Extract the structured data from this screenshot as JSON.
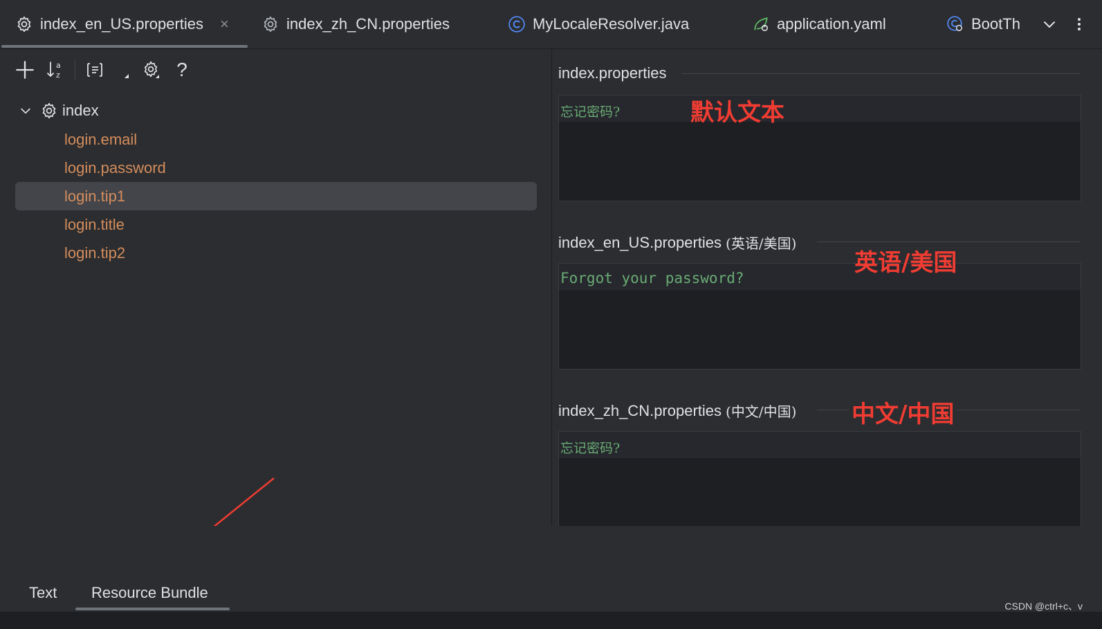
{
  "tabs": [
    {
      "label": "index_en_US.properties",
      "icon": "gear-icon",
      "active": true,
      "close": "×"
    },
    {
      "label": "index_zh_CN.properties",
      "icon": "gear-icon",
      "active": false
    },
    {
      "label": "MyLocaleResolver.java",
      "icon": "class-icon",
      "active": false
    },
    {
      "label": "application.yaml",
      "icon": "spring-icon",
      "active": false
    },
    {
      "label": "BootTh",
      "icon": "boot-icon",
      "active": false
    }
  ],
  "toolbar": {
    "help": "?"
  },
  "tree": {
    "root_label": "index",
    "items": [
      {
        "label": "login.email",
        "selected": false
      },
      {
        "label": "login.password",
        "selected": false
      },
      {
        "label": "login.tip1",
        "selected": true
      },
      {
        "label": "login.title",
        "selected": false
      },
      {
        "label": "login.tip2",
        "selected": false
      }
    ]
  },
  "bottom_tabs": [
    {
      "label": "Text",
      "active": false
    },
    {
      "label": "Resource Bundle",
      "active": true
    }
  ],
  "sections": [
    {
      "title": "index.properties",
      "locale": "",
      "value": "忘记密码?",
      "annotation": "默认文本"
    },
    {
      "title": "index_en_US.properties",
      "locale": "(英语/美国)",
      "value": "Forgot your password?",
      "annotation": "英语/美国"
    },
    {
      "title": "index_zh_CN.properties",
      "locale": "(中文/中国)",
      "value": "忘记密码?",
      "annotation": "中文/中国"
    }
  ],
  "watermark": "CSDN @ctrl+c、v",
  "colors": {
    "key_text": "#d58d5c",
    "value_text": "#6aab73",
    "annotation": "#f03c32",
    "background": "#2b2d30"
  }
}
